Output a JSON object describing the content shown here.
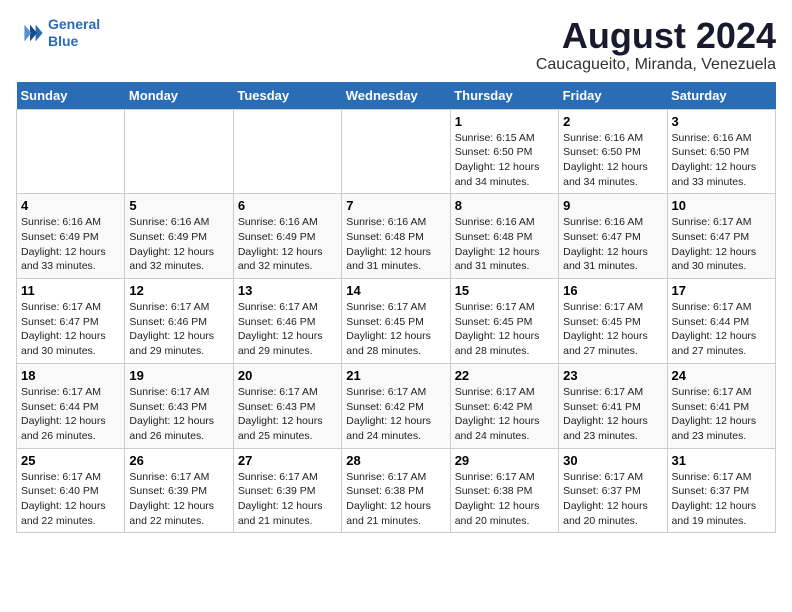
{
  "header": {
    "logo_line1": "General",
    "logo_line2": "Blue",
    "title": "August 2024",
    "subtitle": "Caucagueito, Miranda, Venezuela"
  },
  "days_of_week": [
    "Sunday",
    "Monday",
    "Tuesday",
    "Wednesday",
    "Thursday",
    "Friday",
    "Saturday"
  ],
  "weeks": [
    [
      {
        "day": "",
        "info": ""
      },
      {
        "day": "",
        "info": ""
      },
      {
        "day": "",
        "info": ""
      },
      {
        "day": "",
        "info": ""
      },
      {
        "day": "1",
        "info": "Sunrise: 6:15 AM\nSunset: 6:50 PM\nDaylight: 12 hours\nand 34 minutes."
      },
      {
        "day": "2",
        "info": "Sunrise: 6:16 AM\nSunset: 6:50 PM\nDaylight: 12 hours\nand 34 minutes."
      },
      {
        "day": "3",
        "info": "Sunrise: 6:16 AM\nSunset: 6:50 PM\nDaylight: 12 hours\nand 33 minutes."
      }
    ],
    [
      {
        "day": "4",
        "info": "Sunrise: 6:16 AM\nSunset: 6:49 PM\nDaylight: 12 hours\nand 33 minutes."
      },
      {
        "day": "5",
        "info": "Sunrise: 6:16 AM\nSunset: 6:49 PM\nDaylight: 12 hours\nand 32 minutes."
      },
      {
        "day": "6",
        "info": "Sunrise: 6:16 AM\nSunset: 6:49 PM\nDaylight: 12 hours\nand 32 minutes."
      },
      {
        "day": "7",
        "info": "Sunrise: 6:16 AM\nSunset: 6:48 PM\nDaylight: 12 hours\nand 31 minutes."
      },
      {
        "day": "8",
        "info": "Sunrise: 6:16 AM\nSunset: 6:48 PM\nDaylight: 12 hours\nand 31 minutes."
      },
      {
        "day": "9",
        "info": "Sunrise: 6:16 AM\nSunset: 6:47 PM\nDaylight: 12 hours\nand 31 minutes."
      },
      {
        "day": "10",
        "info": "Sunrise: 6:17 AM\nSunset: 6:47 PM\nDaylight: 12 hours\nand 30 minutes."
      }
    ],
    [
      {
        "day": "11",
        "info": "Sunrise: 6:17 AM\nSunset: 6:47 PM\nDaylight: 12 hours\nand 30 minutes."
      },
      {
        "day": "12",
        "info": "Sunrise: 6:17 AM\nSunset: 6:46 PM\nDaylight: 12 hours\nand 29 minutes."
      },
      {
        "day": "13",
        "info": "Sunrise: 6:17 AM\nSunset: 6:46 PM\nDaylight: 12 hours\nand 29 minutes."
      },
      {
        "day": "14",
        "info": "Sunrise: 6:17 AM\nSunset: 6:45 PM\nDaylight: 12 hours\nand 28 minutes."
      },
      {
        "day": "15",
        "info": "Sunrise: 6:17 AM\nSunset: 6:45 PM\nDaylight: 12 hours\nand 28 minutes."
      },
      {
        "day": "16",
        "info": "Sunrise: 6:17 AM\nSunset: 6:45 PM\nDaylight: 12 hours\nand 27 minutes."
      },
      {
        "day": "17",
        "info": "Sunrise: 6:17 AM\nSunset: 6:44 PM\nDaylight: 12 hours\nand 27 minutes."
      }
    ],
    [
      {
        "day": "18",
        "info": "Sunrise: 6:17 AM\nSunset: 6:44 PM\nDaylight: 12 hours\nand 26 minutes."
      },
      {
        "day": "19",
        "info": "Sunrise: 6:17 AM\nSunset: 6:43 PM\nDaylight: 12 hours\nand 26 minutes."
      },
      {
        "day": "20",
        "info": "Sunrise: 6:17 AM\nSunset: 6:43 PM\nDaylight: 12 hours\nand 25 minutes."
      },
      {
        "day": "21",
        "info": "Sunrise: 6:17 AM\nSunset: 6:42 PM\nDaylight: 12 hours\nand 24 minutes."
      },
      {
        "day": "22",
        "info": "Sunrise: 6:17 AM\nSunset: 6:42 PM\nDaylight: 12 hours\nand 24 minutes."
      },
      {
        "day": "23",
        "info": "Sunrise: 6:17 AM\nSunset: 6:41 PM\nDaylight: 12 hours\nand 23 minutes."
      },
      {
        "day": "24",
        "info": "Sunrise: 6:17 AM\nSunset: 6:41 PM\nDaylight: 12 hours\nand 23 minutes."
      }
    ],
    [
      {
        "day": "25",
        "info": "Sunrise: 6:17 AM\nSunset: 6:40 PM\nDaylight: 12 hours\nand 22 minutes."
      },
      {
        "day": "26",
        "info": "Sunrise: 6:17 AM\nSunset: 6:39 PM\nDaylight: 12 hours\nand 22 minutes."
      },
      {
        "day": "27",
        "info": "Sunrise: 6:17 AM\nSunset: 6:39 PM\nDaylight: 12 hours\nand 21 minutes."
      },
      {
        "day": "28",
        "info": "Sunrise: 6:17 AM\nSunset: 6:38 PM\nDaylight: 12 hours\nand 21 minutes."
      },
      {
        "day": "29",
        "info": "Sunrise: 6:17 AM\nSunset: 6:38 PM\nDaylight: 12 hours\nand 20 minutes."
      },
      {
        "day": "30",
        "info": "Sunrise: 6:17 AM\nSunset: 6:37 PM\nDaylight: 12 hours\nand 20 minutes."
      },
      {
        "day": "31",
        "info": "Sunrise: 6:17 AM\nSunset: 6:37 PM\nDaylight: 12 hours\nand 19 minutes."
      }
    ]
  ]
}
